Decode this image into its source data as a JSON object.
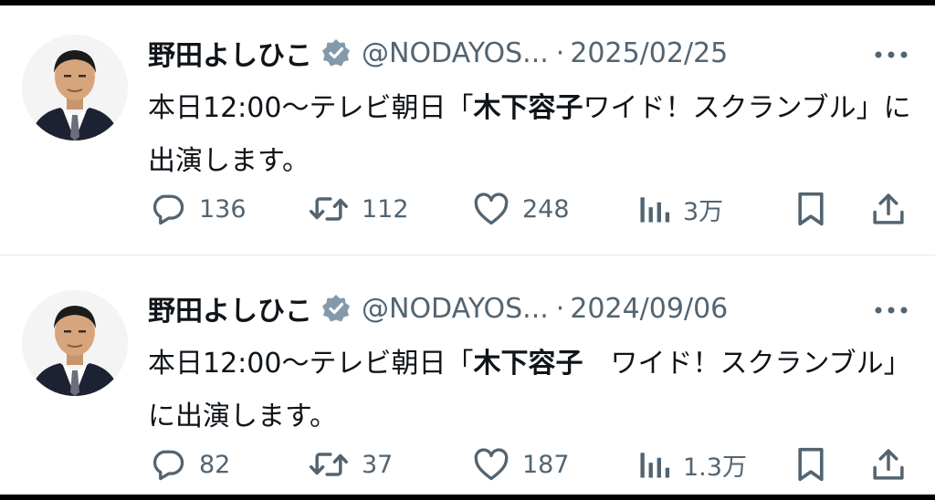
{
  "tweets": [
    {
      "name": "野田よしひこ",
      "handle": "@NODAYOS...",
      "separator": "·",
      "date": "2025/02/25",
      "text_pre": "本日12:00〜テレビ朝日「",
      "text_bold": "木下容子",
      "text_post": "ワイド！スクランブル」に出演します。",
      "replies": "136",
      "retweets": "112",
      "likes": "248",
      "views": "3万"
    },
    {
      "name": "野田よしひこ",
      "handle": "@NODAYOS...",
      "separator": "·",
      "date": "2024/09/06",
      "text_pre": "本日12:00〜テレビ朝日「",
      "text_bold": "木下容子",
      "text_post": "　ワイド！スクランブル」に出演します。",
      "replies": "82",
      "retweets": "37",
      "likes": "187",
      "views": "1.3万"
    }
  ],
  "icons": {
    "more": "more-dots-icon",
    "verified": "verified-badge-icon",
    "reply": "reply-icon",
    "retweet": "retweet-icon",
    "like": "heart-icon",
    "views": "views-icon",
    "bookmark": "bookmark-icon",
    "share": "share-icon"
  },
  "colors": {
    "text": "#0f1419",
    "secondary": "#536471",
    "verified": "#829aab",
    "background": "#ffffff"
  }
}
